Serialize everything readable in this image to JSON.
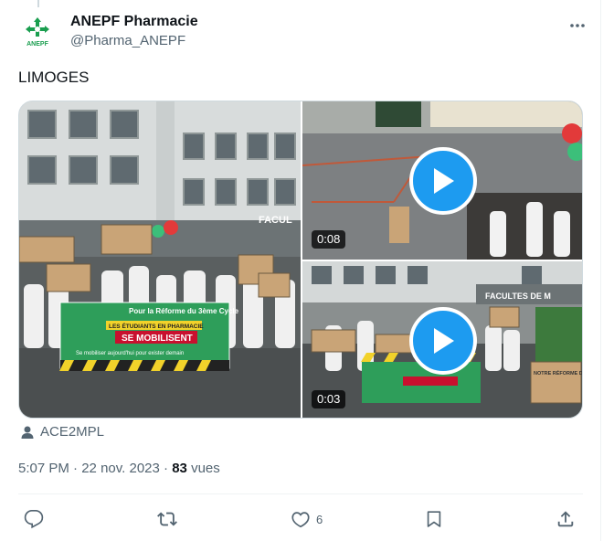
{
  "author": {
    "display_name": "ANEPF Pharmacie",
    "handle": "@Pharma_ANEPF",
    "avatar_text": "ANEPF"
  },
  "tweet": {
    "text": "LIMOGES"
  },
  "media": {
    "items": [
      {
        "type": "photo",
        "banner_line1": "Pour la Réforme du 3ème Cycle",
        "banner_line2": "LES ÉTUDIANTS EN PHARMACIE",
        "banner_line3": "SE MOBILISENT",
        "banner_line4": "Se mobiliser aujourd'hui pour exister demain",
        "sign_faculty": "FACUL"
      },
      {
        "type": "video",
        "duration": "0:08"
      },
      {
        "type": "video",
        "duration": "0:03",
        "sign_faculty": "FACULTES DE M",
        "sign_reform": "NOTRE RÉFORME D'AUJOURD'HUI"
      }
    ]
  },
  "tagged": {
    "label": "ACE2MPL",
    "icon": "person-icon"
  },
  "meta": {
    "time": "5:07 PM",
    "separator": "·",
    "date": "22 nov. 2023",
    "views_count": "83",
    "views_label": "vues"
  },
  "actions": {
    "reply_count": "",
    "retweet_count": "",
    "like_count": "6",
    "bookmark_count": ""
  },
  "colors": {
    "accent": "#1d9bf0",
    "text_primary": "#0f1419",
    "text_secondary": "#536471",
    "banner_green": "#2e9e5a",
    "banner_red": "#c8102e"
  }
}
